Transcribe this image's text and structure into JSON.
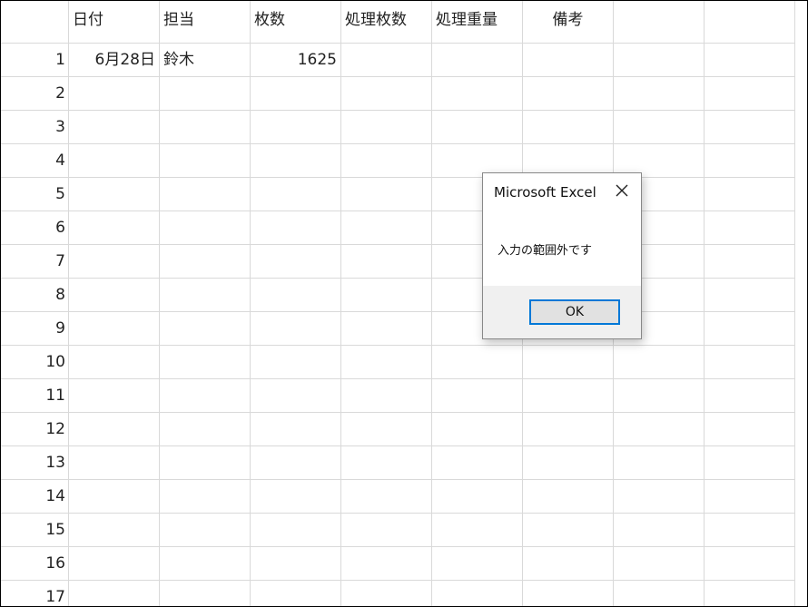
{
  "headers": [
    "日付",
    "担当",
    "枚数",
    "処理枚数",
    "処理重量",
    "備考",
    "",
    ""
  ],
  "rows": [
    {
      "num": "1",
      "cells": [
        "6月28日",
        "鈴木",
        "1625",
        "",
        "",
        "",
        "",
        ""
      ]
    },
    {
      "num": "2",
      "cells": [
        "",
        "",
        "",
        "",
        "",
        "",
        "",
        ""
      ]
    },
    {
      "num": "3",
      "cells": [
        "",
        "",
        "",
        "",
        "",
        "",
        "",
        ""
      ]
    },
    {
      "num": "4",
      "cells": [
        "",
        "",
        "",
        "",
        "",
        "",
        "",
        ""
      ]
    },
    {
      "num": "5",
      "cells": [
        "",
        "",
        "",
        "",
        "",
        "",
        "",
        ""
      ]
    },
    {
      "num": "6",
      "cells": [
        "",
        "",
        "",
        "",
        "",
        "",
        "",
        ""
      ]
    },
    {
      "num": "7",
      "cells": [
        "",
        "",
        "",
        "",
        "",
        "",
        "",
        ""
      ]
    },
    {
      "num": "8",
      "cells": [
        "",
        "",
        "",
        "",
        "",
        "",
        "",
        ""
      ]
    },
    {
      "num": "9",
      "cells": [
        "",
        "",
        "",
        "",
        "",
        "",
        "",
        ""
      ]
    },
    {
      "num": "10",
      "cells": [
        "",
        "",
        "",
        "",
        "",
        "",
        "",
        ""
      ]
    },
    {
      "num": "11",
      "cells": [
        "",
        "",
        "",
        "",
        "",
        "",
        "",
        ""
      ]
    },
    {
      "num": "12",
      "cells": [
        "",
        "",
        "",
        "",
        "",
        "",
        "",
        ""
      ]
    },
    {
      "num": "13",
      "cells": [
        "",
        "",
        "",
        "",
        "",
        "",
        "",
        ""
      ]
    },
    {
      "num": "14",
      "cells": [
        "",
        "",
        "",
        "",
        "",
        "",
        "",
        ""
      ]
    },
    {
      "num": "15",
      "cells": [
        "",
        "",
        "",
        "",
        "",
        "",
        "",
        ""
      ]
    },
    {
      "num": "16",
      "cells": [
        "",
        "",
        "",
        "",
        "",
        "",
        "",
        ""
      ]
    },
    {
      "num": "17",
      "cells": [
        "",
        "",
        "",
        "",
        "",
        "",
        "",
        ""
      ]
    }
  ],
  "dialog": {
    "title": "Microsoft Excel",
    "close_icon": "close-icon",
    "message": "入力の範囲外です",
    "ok_label": "OK",
    "accent_color": "#0078d7"
  }
}
